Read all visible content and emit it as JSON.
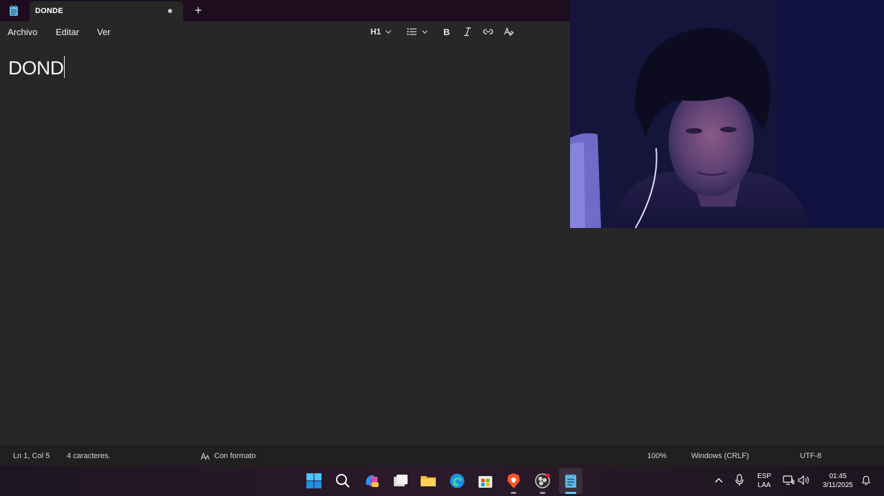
{
  "app": {
    "tab_title": "DONDE",
    "new_tab_symbol": "+"
  },
  "menu": {
    "archivo": "Archivo",
    "editar": "Editar",
    "ver": "Ver"
  },
  "toolbar": {
    "heading_label": "H1",
    "icons": [
      "heading-dropdown",
      "list-icon",
      "bold-icon",
      "italic-icon",
      "link-icon",
      "clear-format-icon"
    ]
  },
  "editor": {
    "content": "DOND"
  },
  "status": {
    "position": "Ln 1, Col 5",
    "characters": "4 caracteres.",
    "format": "Con formato",
    "zoom": "100%",
    "line_ending": "Windows (CRLF)",
    "encoding": "UTF-8"
  },
  "taskbar": {
    "apps": [
      "windows-start-icon",
      "search-icon",
      "copilot-icon",
      "file-explorer-icon",
      "folder-icon",
      "edge-icon",
      "store-icon",
      "brave-icon",
      "obs-icon",
      "notepad-icon"
    ],
    "language_line1": "ESP",
    "language_line2": "LAA",
    "time": "01:45",
    "date": "3/11/2025"
  },
  "colors": {
    "background": "#272727",
    "titlebar": "#1d0d1f",
    "statusbar": "#202020",
    "accent": "#60cdff"
  }
}
